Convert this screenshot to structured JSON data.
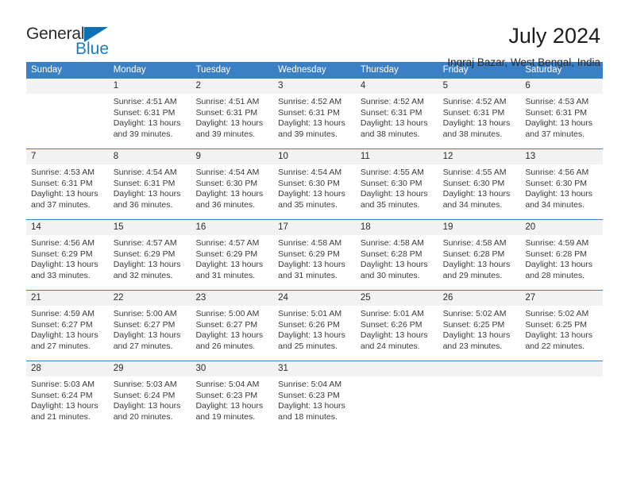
{
  "brand": {
    "name_top": "General",
    "name_bottom": "Blue",
    "accent_color": "#0f6fb3"
  },
  "header": {
    "title": "July 2024",
    "location": "Ingraj Bazar, West Bengal, India"
  },
  "theme": {
    "header_blue": "#3b7fc4",
    "num_band": "#f2f2f2",
    "text": "#3a3a3a"
  },
  "weekdays": [
    "Sunday",
    "Monday",
    "Tuesday",
    "Wednesday",
    "Thursday",
    "Friday",
    "Saturday"
  ],
  "labels": {
    "sunrise_prefix": "Sunrise:",
    "sunset_prefix": "Sunset:",
    "daylight_prefix": "Daylight:"
  },
  "weeks": [
    {
      "days": [
        {
          "num": "",
          "lines": []
        },
        {
          "num": "1",
          "lines": [
            "Sunrise: 4:51 AM",
            "Sunset: 6:31 PM",
            "Daylight: 13 hours",
            "and 39 minutes."
          ]
        },
        {
          "num": "2",
          "lines": [
            "Sunrise: 4:51 AM",
            "Sunset: 6:31 PM",
            "Daylight: 13 hours",
            "and 39 minutes."
          ]
        },
        {
          "num": "3",
          "lines": [
            "Sunrise: 4:52 AM",
            "Sunset: 6:31 PM",
            "Daylight: 13 hours",
            "and 39 minutes."
          ]
        },
        {
          "num": "4",
          "lines": [
            "Sunrise: 4:52 AM",
            "Sunset: 6:31 PM",
            "Daylight: 13 hours",
            "and 38 minutes."
          ]
        },
        {
          "num": "5",
          "lines": [
            "Sunrise: 4:52 AM",
            "Sunset: 6:31 PM",
            "Daylight: 13 hours",
            "and 38 minutes."
          ]
        },
        {
          "num": "6",
          "lines": [
            "Sunrise: 4:53 AM",
            "Sunset: 6:31 PM",
            "Daylight: 13 hours",
            "and 37 minutes."
          ]
        }
      ]
    },
    {
      "days": [
        {
          "num": "7",
          "lines": [
            "Sunrise: 4:53 AM",
            "Sunset: 6:31 PM",
            "Daylight: 13 hours",
            "and 37 minutes."
          ]
        },
        {
          "num": "8",
          "lines": [
            "Sunrise: 4:54 AM",
            "Sunset: 6:31 PM",
            "Daylight: 13 hours",
            "and 36 minutes."
          ]
        },
        {
          "num": "9",
          "lines": [
            "Sunrise: 4:54 AM",
            "Sunset: 6:30 PM",
            "Daylight: 13 hours",
            "and 36 minutes."
          ]
        },
        {
          "num": "10",
          "lines": [
            "Sunrise: 4:54 AM",
            "Sunset: 6:30 PM",
            "Daylight: 13 hours",
            "and 35 minutes."
          ]
        },
        {
          "num": "11",
          "lines": [
            "Sunrise: 4:55 AM",
            "Sunset: 6:30 PM",
            "Daylight: 13 hours",
            "and 35 minutes."
          ]
        },
        {
          "num": "12",
          "lines": [
            "Sunrise: 4:55 AM",
            "Sunset: 6:30 PM",
            "Daylight: 13 hours",
            "and 34 minutes."
          ]
        },
        {
          "num": "13",
          "lines": [
            "Sunrise: 4:56 AM",
            "Sunset: 6:30 PM",
            "Daylight: 13 hours",
            "and 34 minutes."
          ]
        }
      ]
    },
    {
      "days": [
        {
          "num": "14",
          "lines": [
            "Sunrise: 4:56 AM",
            "Sunset: 6:29 PM",
            "Daylight: 13 hours",
            "and 33 minutes."
          ]
        },
        {
          "num": "15",
          "lines": [
            "Sunrise: 4:57 AM",
            "Sunset: 6:29 PM",
            "Daylight: 13 hours",
            "and 32 minutes."
          ]
        },
        {
          "num": "16",
          "lines": [
            "Sunrise: 4:57 AM",
            "Sunset: 6:29 PM",
            "Daylight: 13 hours",
            "and 31 minutes."
          ]
        },
        {
          "num": "17",
          "lines": [
            "Sunrise: 4:58 AM",
            "Sunset: 6:29 PM",
            "Daylight: 13 hours",
            "and 31 minutes."
          ]
        },
        {
          "num": "18",
          "lines": [
            "Sunrise: 4:58 AM",
            "Sunset: 6:28 PM",
            "Daylight: 13 hours",
            "and 30 minutes."
          ]
        },
        {
          "num": "19",
          "lines": [
            "Sunrise: 4:58 AM",
            "Sunset: 6:28 PM",
            "Daylight: 13 hours",
            "and 29 minutes."
          ]
        },
        {
          "num": "20",
          "lines": [
            "Sunrise: 4:59 AM",
            "Sunset: 6:28 PM",
            "Daylight: 13 hours",
            "and 28 minutes."
          ]
        }
      ]
    },
    {
      "days": [
        {
          "num": "21",
          "lines": [
            "Sunrise: 4:59 AM",
            "Sunset: 6:27 PM",
            "Daylight: 13 hours",
            "and 27 minutes."
          ]
        },
        {
          "num": "22",
          "lines": [
            "Sunrise: 5:00 AM",
            "Sunset: 6:27 PM",
            "Daylight: 13 hours",
            "and 27 minutes."
          ]
        },
        {
          "num": "23",
          "lines": [
            "Sunrise: 5:00 AM",
            "Sunset: 6:27 PM",
            "Daylight: 13 hours",
            "and 26 minutes."
          ]
        },
        {
          "num": "24",
          "lines": [
            "Sunrise: 5:01 AM",
            "Sunset: 6:26 PM",
            "Daylight: 13 hours",
            "and 25 minutes."
          ]
        },
        {
          "num": "25",
          "lines": [
            "Sunrise: 5:01 AM",
            "Sunset: 6:26 PM",
            "Daylight: 13 hours",
            "and 24 minutes."
          ]
        },
        {
          "num": "26",
          "lines": [
            "Sunrise: 5:02 AM",
            "Sunset: 6:25 PM",
            "Daylight: 13 hours",
            "and 23 minutes."
          ]
        },
        {
          "num": "27",
          "lines": [
            "Sunrise: 5:02 AM",
            "Sunset: 6:25 PM",
            "Daylight: 13 hours",
            "and 22 minutes."
          ]
        }
      ]
    },
    {
      "days": [
        {
          "num": "28",
          "lines": [
            "Sunrise: 5:03 AM",
            "Sunset: 6:24 PM",
            "Daylight: 13 hours",
            "and 21 minutes."
          ]
        },
        {
          "num": "29",
          "lines": [
            "Sunrise: 5:03 AM",
            "Sunset: 6:24 PM",
            "Daylight: 13 hours",
            "and 20 minutes."
          ]
        },
        {
          "num": "30",
          "lines": [
            "Sunrise: 5:04 AM",
            "Sunset: 6:23 PM",
            "Daylight: 13 hours",
            "and 19 minutes."
          ]
        },
        {
          "num": "31",
          "lines": [
            "Sunrise: 5:04 AM",
            "Sunset: 6:23 PM",
            "Daylight: 13 hours",
            "and 18 minutes."
          ]
        },
        {
          "num": "",
          "lines": []
        },
        {
          "num": "",
          "lines": []
        },
        {
          "num": "",
          "lines": []
        }
      ]
    }
  ]
}
